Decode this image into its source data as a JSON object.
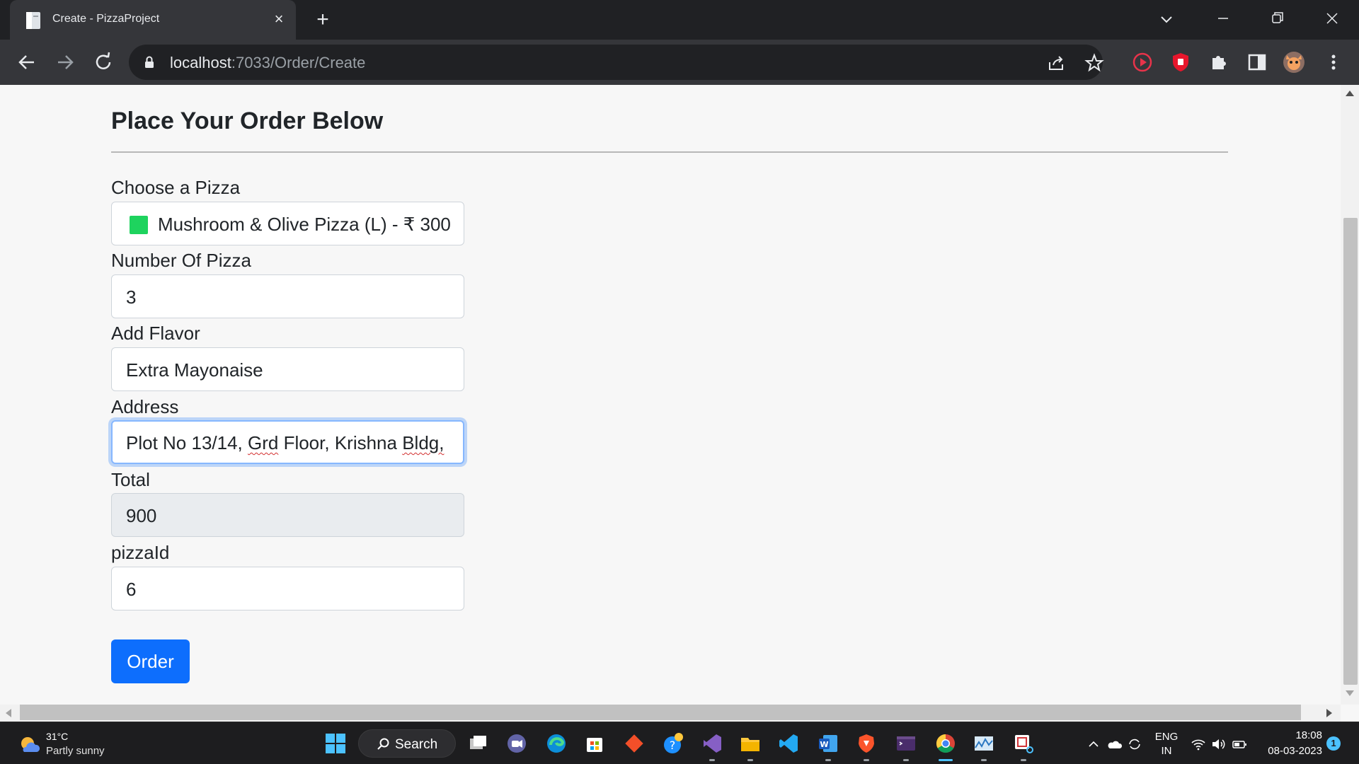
{
  "browser": {
    "tab": {
      "title": "Create - PizzaProject",
      "favicon": "document-icon",
      "close_icon": "×"
    },
    "new_tab_icon": "+",
    "address": {
      "host": "localhost",
      "path": ":7033/Order/Create"
    }
  },
  "page": {
    "title": "Place Your Order Below",
    "form": {
      "pizza_label": "Choose a Pizza",
      "pizza_value": "Mushroom & Olive Pizza (L) - ₹ 300",
      "pizza_swatch_color": "#1ed35e",
      "count_label": "Number Of Pizza",
      "count_value": "3",
      "flavor_label": "Add Flavor",
      "flavor_value": "Extra Mayonaise",
      "address_label": "Address",
      "address_parts": [
        "Plot No 13/14, ",
        "Grd",
        " Floor, Krishna ",
        "Bldg,"
      ],
      "total_label": "Total",
      "total_value": "900",
      "pizzaid_label": "pizzaId",
      "pizzaid_value": "6",
      "order_button": "Order"
    },
    "colors": {
      "primary": "#0d6efd",
      "focus_ring": "#86b7fe"
    }
  },
  "taskbar": {
    "weather": {
      "temp": "31°C",
      "desc": "Partly sunny"
    },
    "search_label": "Search",
    "apps": [
      "start-icon",
      "task-view-icon",
      "chat-icon",
      "edge-icon",
      "store-icon",
      "git-icon",
      "help-icon",
      "visual-studio-icon",
      "file-explorer-icon",
      "vscode-icon",
      "word-icon",
      "brave-icon",
      "terminal-icon",
      "chrome-icon",
      "resource-monitor-icon",
      "snipping-tool-icon"
    ],
    "tray": {
      "lang_top": "ENG",
      "lang_bottom": "IN",
      "time": "18:08",
      "date": "08-03-2023",
      "notifications": "1"
    }
  }
}
